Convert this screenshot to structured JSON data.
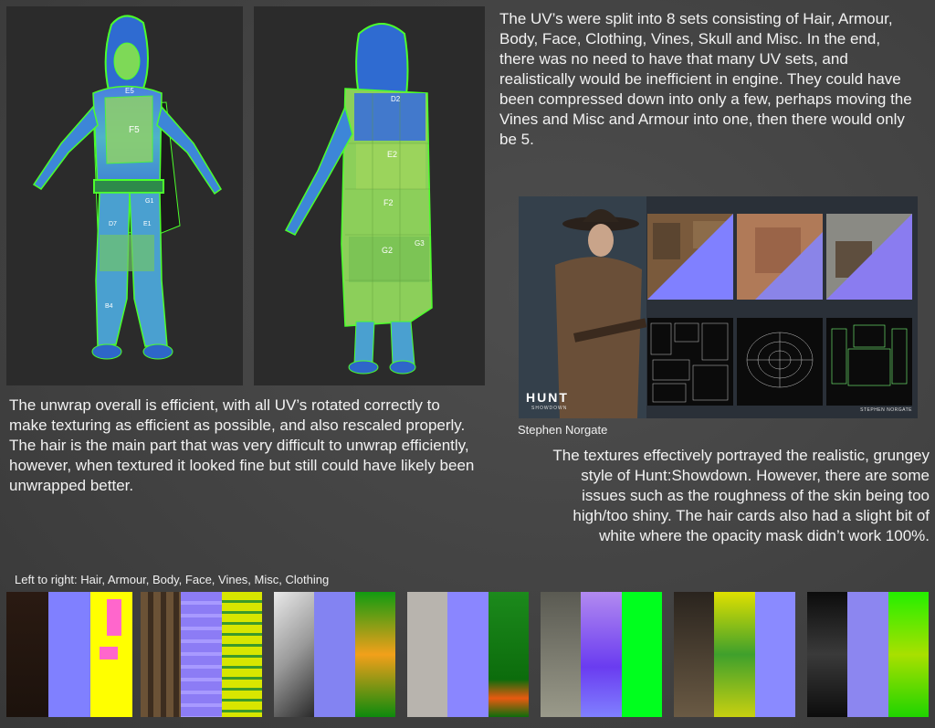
{
  "paragraphs": {
    "uv_sets": "The UV’s were split into 8 sets consisting of Hair, Armour, Body, Face, Clothing, Vines, Skull and Misc. In the end, there was no need to have that many UV sets, and realistically would be inefficient in engine. They could have been compressed down into only a few, perhaps moving the Vines and Misc and Armour into one, then there would only be 5.",
    "unwrap": "The unwrap overall is efficient, with all UV’s rotated correctly to make texturing as efficient as possible, and also rescaled properly. The hair is the main part that was very difficult to unwrap efficiently, however, when textured it looked fine but still could have likely been unwrapped better.",
    "textures": "The textures effectively portrayed the realistic, grungey style of Hunt:Showdown. However, there are some issues such as the roughness of the skin being too high/too shiny. The hair cards also had a slight bit of white where the opacity mask didn’t work 100%."
  },
  "reference": {
    "credit_caption": "Stephen Norgate",
    "logo_text": "HUNT",
    "logo_sub": "SHOWDOWN",
    "signature": "STEPHEN NORGATE"
  },
  "uv_labels": {
    "front": [
      "E5",
      "F5",
      "G1",
      "D7",
      "E1",
      "B4"
    ],
    "back": [
      "D2",
      "E2",
      "F2",
      "G2",
      "G3"
    ]
  },
  "strips_caption": "Left to right: Hair, Armour, Body, Face, Vines, Misc, Clothing",
  "strip_names": [
    "Hair",
    "Armour",
    "Body",
    "Face",
    "Vines",
    "Misc",
    "Clothing"
  ],
  "colors": {
    "normal_map": "#8080ff",
    "uv_green": "#7ed957",
    "uv_blue": "#3a6fd8",
    "wire": "#4cff2b"
  }
}
